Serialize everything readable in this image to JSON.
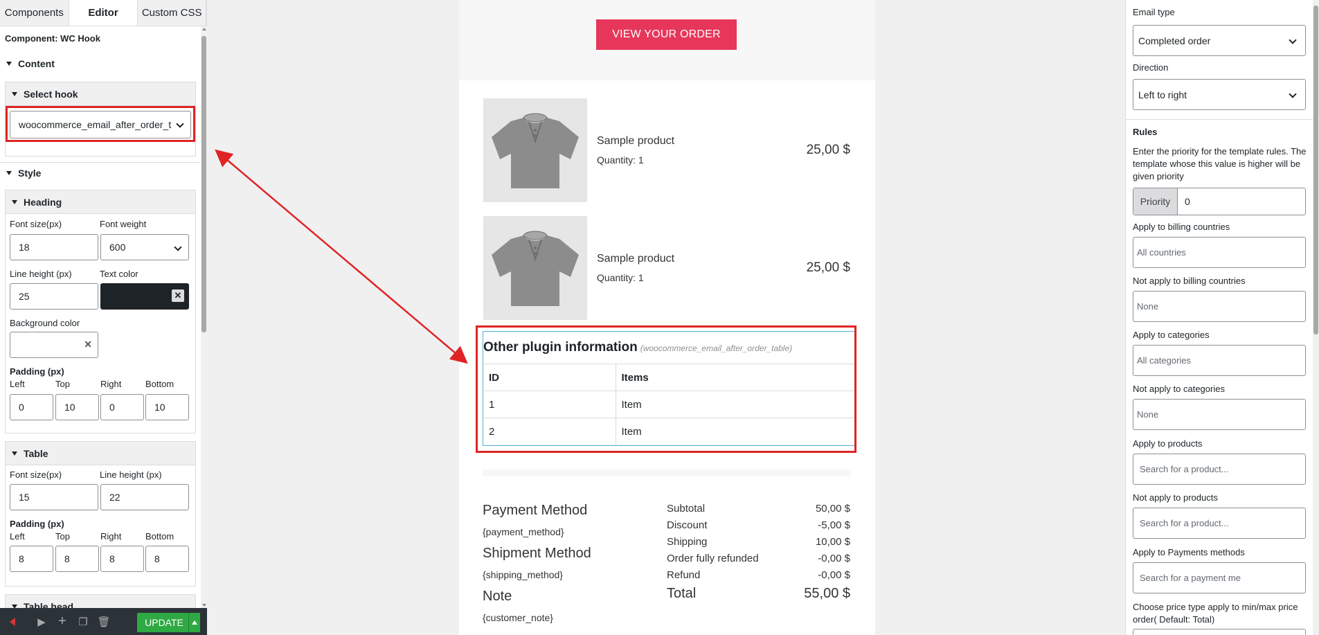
{
  "left_panel": {
    "tabs": [
      "Components",
      "Editor",
      "Custom CSS"
    ],
    "component_title": "Component: WC Hook",
    "content_section": "Content",
    "select_hook_label": "Select hook",
    "hook_value": "woocommerce_email_after_order_t",
    "style_section": "Style",
    "heading_group": {
      "title": "Heading",
      "font_size_label": "Font size(px)",
      "font_size": "18",
      "font_weight_label": "Font weight",
      "font_weight": "600",
      "line_height_label": "Line height (px)",
      "line_height": "25",
      "text_color_label": "Text color",
      "text_color": "#1d2327",
      "bg_color_label": "Background color",
      "padding_label": "Padding (px)",
      "pad_labels": [
        "Left",
        "Top",
        "Right",
        "Bottom"
      ],
      "pad_values": [
        "0",
        "10",
        "0",
        "10"
      ]
    },
    "table_group": {
      "title": "Table",
      "font_size_label": "Font size(px)",
      "font_size": "15",
      "line_height_label": "Line height (px)",
      "line_height": "22",
      "padding_label": "Padding (px)",
      "pad_labels": [
        "Left",
        "Top",
        "Right",
        "Bottom"
      ],
      "pad_values": [
        "8",
        "8",
        "8",
        "8"
      ]
    },
    "table_head_group": "Table head",
    "update_label": "UPDATE"
  },
  "email": {
    "order_button": "VIEW YOUR ORDER",
    "products": [
      {
        "name": "Sample product",
        "qty": "Quantity: 1",
        "price": "25,00 $"
      },
      {
        "name": "Sample product",
        "qty": "Quantity: 1",
        "price": "25,00 $"
      }
    ],
    "plugin": {
      "title": "Other plugin information",
      "hook": "(woocommerce_email_after_order_table)",
      "headers": [
        "ID",
        "Items"
      ],
      "rows": [
        [
          "1",
          "Item"
        ],
        [
          "2",
          "Item"
        ]
      ]
    },
    "payment_method_label": "Payment Method",
    "payment_method_value": "{payment_method}",
    "shipment_method_label": "Shipment Method",
    "shipment_method_value": "{shipping_method}",
    "note_label": "Note",
    "note_value": "{customer_note}",
    "totals": [
      {
        "label": "Subtotal",
        "value": "50,00 $"
      },
      {
        "label": "Discount",
        "value": "-5,00 $"
      },
      {
        "label": "Shipping",
        "value": "10,00 $"
      },
      {
        "label": "Order fully refunded",
        "value": "-0,00 $"
      },
      {
        "label": "Refund",
        "value": "-0,00 $"
      }
    ],
    "total_label": "Total",
    "total_value": "55,00 $"
  },
  "right_panel": {
    "email_type_label": "Email type",
    "email_type_value": "Completed order",
    "direction_label": "Direction",
    "direction_value": "Left to right",
    "rules_label": "Rules",
    "rules_help": "Enter the priority for the template rules. The template whose this value is higher will be given priority",
    "priority_label": "Priority",
    "priority_value": "0",
    "fields": [
      {
        "label": "Apply to billing countries",
        "placeholder": "All countries"
      },
      {
        "label": "Not apply to billing countries",
        "placeholder": "None"
      },
      {
        "label": "Apply to categories",
        "placeholder": "All categories"
      },
      {
        "label": "Not apply to categories",
        "placeholder": "None"
      },
      {
        "label": "Apply to products",
        "placeholder": "Search for a product..."
      },
      {
        "label": "Not apply to products",
        "placeholder": "Search for a product..."
      },
      {
        "label": "Apply to Payments methods",
        "placeholder": "Search for a payment me"
      }
    ],
    "price_type_label": "Choose price type apply to min/max price order( Default: Total)"
  },
  "colors": {
    "accent_red": "#e02424",
    "order_button": "#e6375a",
    "update_green": "#2ea943",
    "plugin_border": "#4fb0d8"
  }
}
